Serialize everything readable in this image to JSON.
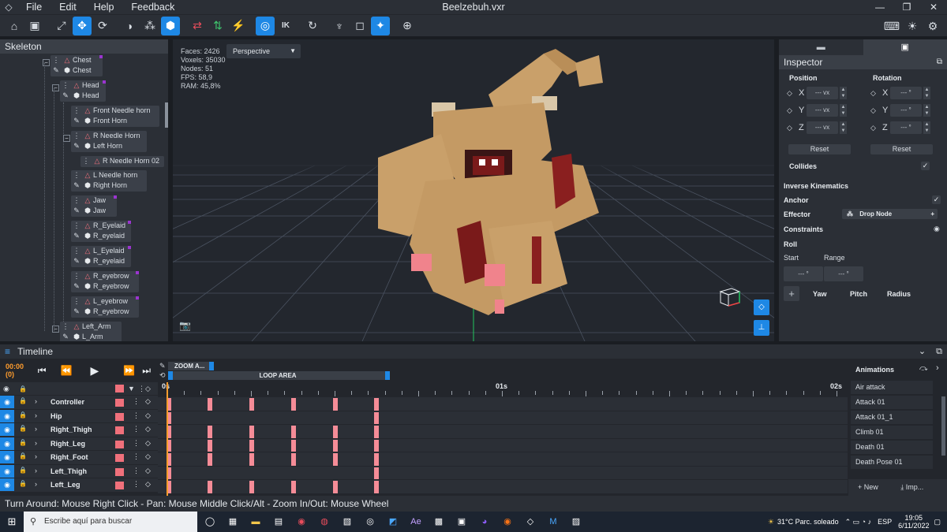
{
  "window": {
    "title": "Beelzebuh.vxr",
    "menus": [
      "File",
      "Edit",
      "Help",
      "Feedback"
    ]
  },
  "skeleton": {
    "title": "Skeleton",
    "nodes": [
      {
        "bone": "Chest",
        "mesh": "Chest"
      },
      {
        "bone": "Head",
        "mesh": "Head"
      },
      {
        "bone": "Front Needle horn",
        "mesh": "Front Horn"
      },
      {
        "bone": "R Needle Horn",
        "mesh": "Left Horn"
      },
      {
        "bone": "R Needle Horn 02",
        "mesh": ""
      },
      {
        "bone": "L Needle horn",
        "mesh": "Right Horn"
      },
      {
        "bone": "Jaw",
        "mesh": "Jaw"
      },
      {
        "bone": "R_Eyelaid",
        "mesh": "R_eyelaid"
      },
      {
        "bone": "L_Eyelaid",
        "mesh": "R_eyelaid"
      },
      {
        "bone": "R_eyebrow",
        "mesh": "R_eyebrow"
      },
      {
        "bone": "L_eyebrow",
        "mesh": "R_eyebrow"
      },
      {
        "bone": "Left_Arm",
        "mesh": "L_Arm"
      }
    ]
  },
  "viewport": {
    "stats": {
      "faces": "Faces: 2426",
      "voxels": "Voxels: 35030",
      "nodes": "Nodes: 51",
      "fps": "FPS: 58,9",
      "ram": "RAM: 45,8%"
    },
    "camera_mode": "Perspective"
  },
  "inspector": {
    "title": "Inspector",
    "position_label": "Position",
    "rotation_label": "Rotation",
    "axes": [
      "X",
      "Y",
      "Z"
    ],
    "position_value": "--- vx",
    "rotation_value": "--- °",
    "reset_label": "Reset",
    "collides_label": "Collides",
    "ik_label": "Inverse Kinematics",
    "anchor_label": "Anchor",
    "effector_label": "Effector",
    "effector_value": "Drop Node",
    "constraints_label": "Constraints",
    "roll_label": "Roll",
    "start_label": "Start",
    "range_label": "Range",
    "start_value": "--- °",
    "range_value": "--- °",
    "yaw_label": "Yaw",
    "pitch_label": "Pitch",
    "radius_label": "Radius"
  },
  "timeline": {
    "title": "Timeline",
    "current_time": "00:00 (0)",
    "zoom_label": "ZOOM A...",
    "loop_label": "LOOP AREA",
    "ruler_labels": [
      "0s",
      "01s",
      "02s"
    ],
    "tracks": [
      "Controller",
      "Hip",
      "Right_Thigh",
      "Right_Leg",
      "Right_Foot",
      "Left_Thigh",
      "Left_Leg"
    ],
    "animations_title": "Animations",
    "animations": [
      "Air attack",
      "Attack 01",
      "Attack 01_1",
      "Climb 01",
      "Death 01",
      "Death Pose 01"
    ],
    "new_label": "New",
    "import_label": "Imp..."
  },
  "status_text": "Turn Around: Mouse Right Click - Pan: Mouse Middle Click/Alt - Zoom In/Out: Mouse Wheel",
  "taskbar": {
    "search_placeholder": "Escribe aquí para buscar",
    "weather": "31°C  Parc. soleado",
    "language": "ESP",
    "time": "19:05",
    "date": "6/11/2022"
  },
  "colors": {
    "accent": "#1e88e5",
    "keyframe": "#f58c97",
    "playhead": "#ff9d2e",
    "panel": "#2b2f36"
  }
}
